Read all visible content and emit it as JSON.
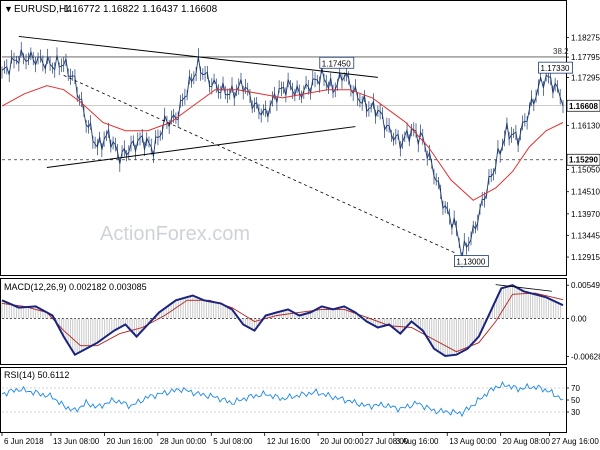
{
  "chart_data": [
    {
      "type": "line",
      "title": "EURUSD,H4",
      "ohlc": [
        1.16772,
        1.16822,
        1.16437,
        1.16608
      ],
      "subtype": "candlestick",
      "ylim": [
        1.1255,
        1.1875
      ],
      "y_ticks": [
        "1.18275",
        "1.17795",
        "1.17295",
        "1.16608",
        "1.16130",
        "1.15290",
        "1.15050",
        "1.14510",
        "1.13970",
        "1.13445",
        "1.12915"
      ],
      "x_ticks": [
        "6 Jun 2018",
        "13 Jun 08:00",
        "20 Jun 16:00",
        "28 Jun 00:00",
        "5 Jul 08:00",
        "12 Jul 16:00",
        "20 Jul 00:00",
        "27 Jul 08:00",
        "3 Aug 16:00",
        "13 Aug 00:00",
        "20 Aug 08:00",
        "27 Aug 16:00"
      ],
      "price_path": [
        [
          0,
          1.174
        ],
        [
          3,
          1.178
        ],
        [
          6,
          1.1775
        ],
        [
          9,
          1.176
        ],
        [
          11,
          1.1765
        ],
        [
          13,
          1.172
        ],
        [
          15,
          1.1625
        ],
        [
          17,
          1.156
        ],
        [
          19,
          1.159
        ],
        [
          21,
          1.1535
        ],
        [
          23,
          1.156
        ],
        [
          25,
          1.158
        ],
        [
          27,
          1.1555
        ],
        [
          29,
          1.162
        ],
        [
          31,
          1.163
        ],
        [
          33,
          1.17
        ],
        [
          35,
          1.176
        ],
        [
          37,
          1.172
        ],
        [
          39,
          1.17
        ],
        [
          41,
          1.169
        ],
        [
          43,
          1.1715
        ],
        [
          45,
          1.166
        ],
        [
          47,
          1.164
        ],
        [
          49,
          1.169
        ],
        [
          51,
          1.171
        ],
        [
          53,
          1.169
        ],
        [
          55,
          1.171
        ],
        [
          57,
          1.1735
        ],
        [
          59,
          1.17
        ],
        [
          61,
          1.174
        ],
        [
          63,
          1.169
        ],
        [
          65,
          1.166
        ],
        [
          67,
          1.165
        ],
        [
          69,
          1.16
        ],
        [
          71,
          1.157
        ],
        [
          73,
          1.16
        ],
        [
          75,
          1.158
        ],
        [
          77,
          1.15
        ],
        [
          79,
          1.141
        ],
        [
          81,
          1.136
        ],
        [
          82,
          1.13
        ],
        [
          84,
          1.135
        ],
        [
          86,
          1.144
        ],
        [
          88,
          1.152
        ],
        [
          90,
          1.16
        ],
        [
          92,
          1.158
        ],
        [
          94,
          1.165
        ],
        [
          96,
          1.1715
        ],
        [
          97,
          1.1733
        ],
        [
          99,
          1.17
        ],
        [
          100,
          1.16608
        ]
      ],
      "ma_path": [
        [
          0,
          1.166
        ],
        [
          4,
          1.169
        ],
        [
          8,
          1.171
        ],
        [
          11,
          1.17
        ],
        [
          14,
          1.167
        ],
        [
          18,
          1.162
        ],
        [
          22,
          1.16
        ],
        [
          26,
          1.16
        ],
        [
          30,
          1.162
        ],
        [
          34,
          1.166
        ],
        [
          38,
          1.17
        ],
        [
          42,
          1.17
        ],
        [
          46,
          1.169
        ],
        [
          50,
          1.168
        ],
        [
          54,
          1.169
        ],
        [
          58,
          1.17
        ],
        [
          62,
          1.17
        ],
        [
          66,
          1.168
        ],
        [
          70,
          1.164
        ],
        [
          72,
          1.162
        ],
        [
          76,
          1.156
        ],
        [
          80,
          1.148
        ],
        [
          84,
          1.143
        ],
        [
          88,
          1.146
        ],
        [
          91,
          1.15
        ],
        [
          94,
          1.156
        ],
        [
          97,
          1.16
        ],
        [
          100,
          1.162
        ]
      ],
      "support_line": [
        [
          8,
          1.151
        ],
        [
          63,
          1.161
        ]
      ],
      "resistance_line": [
        [
          3,
          1.183
        ],
        [
          67,
          1.173
        ]
      ],
      "trend_dotted": [
        [
          11,
          1.1735
        ],
        [
          81,
          1.13
        ]
      ],
      "fib_level": 1.178,
      "fib_label": "38.2",
      "dotted_level": 1.1529,
      "price_labels": [
        {
          "text": "1.17450",
          "x": 57,
          "y": 1.1745
        },
        {
          "text": "1.17330",
          "x": 96,
          "y": 1.1733
        },
        {
          "text": "1.13000",
          "x": 81,
          "y": 1.13
        }
      ],
      "right_labels": [
        {
          "text": "1.16608",
          "value": 1.16608
        },
        {
          "text": "1.15290",
          "value": 1.1529
        }
      ],
      "watermark": "ActionForex.com"
    },
    {
      "type": "line",
      "title": "MACD(12,26,9) 0.002182 0.003085",
      "ylim": [
        -0.0072,
        0.0062
      ],
      "y_ticks": [
        "0.005499",
        "0.00",
        "-0.006283"
      ],
      "macd_path": [
        [
          0,
          0.003
        ],
        [
          3,
          0.0018
        ],
        [
          6,
          0.002
        ],
        [
          9,
          0.0005
        ],
        [
          11,
          -0.003
        ],
        [
          13,
          -0.006
        ],
        [
          15,
          -0.005
        ],
        [
          17,
          -0.004
        ],
        [
          20,
          -0.002
        ],
        [
          22,
          -0.001
        ],
        [
          24,
          -0.003
        ],
        [
          26,
          -0.001
        ],
        [
          28,
          0.001
        ],
        [
          31,
          0.003
        ],
        [
          34,
          0.0038
        ],
        [
          36,
          0.003
        ],
        [
          39,
          0.0025
        ],
        [
          41,
          0.0015
        ],
        [
          43,
          -0.001
        ],
        [
          45,
          -0.002
        ],
        [
          47,
          0.0005
        ],
        [
          49,
          0.001
        ],
        [
          51,
          0.0015
        ],
        [
          53,
          0.0005
        ],
        [
          55,
          0.001
        ],
        [
          57,
          0.002
        ],
        [
          59,
          0.0015
        ],
        [
          61,
          0.002
        ],
        [
          63,
          0.001
        ],
        [
          65,
          -0.0005
        ],
        [
          67,
          -0.0015
        ],
        [
          69,
          -0.001
        ],
        [
          71,
          -0.0025
        ],
        [
          73,
          -0.0005
        ],
        [
          75,
          -0.002
        ],
        [
          77,
          -0.005
        ],
        [
          79,
          -0.0062
        ],
        [
          81,
          -0.006
        ],
        [
          83,
          -0.005
        ],
        [
          85,
          -0.003
        ],
        [
          87,
          0.001
        ],
        [
          89,
          0.005
        ],
        [
          91,
          0.0055
        ],
        [
          93,
          0.0045
        ],
        [
          95,
          0.004
        ],
        [
          97,
          0.0035
        ],
        [
          100,
          0.0022
        ]
      ],
      "signal_path": [
        [
          0,
          0.0025
        ],
        [
          4,
          0.002
        ],
        [
          8,
          0.001
        ],
        [
          11,
          -0.002
        ],
        [
          14,
          -0.0045
        ],
        [
          17,
          -0.0045
        ],
        [
          21,
          -0.0025
        ],
        [
          25,
          -0.0015
        ],
        [
          29,
          0.0005
        ],
        [
          33,
          0.003
        ],
        [
          37,
          0.003
        ],
        [
          41,
          0.0018
        ],
        [
          45,
          -0.0005
        ],
        [
          49,
          0.0005
        ],
        [
          53,
          0.001
        ],
        [
          57,
          0.0015
        ],
        [
          61,
          0.0015
        ],
        [
          65,
          0.0002
        ],
        [
          69,
          -0.0012
        ],
        [
          73,
          -0.0015
        ],
        [
          77,
          -0.0035
        ],
        [
          81,
          -0.0055
        ],
        [
          85,
          -0.004
        ],
        [
          88,
          -0.0005
        ],
        [
          91,
          0.004
        ],
        [
          95,
          0.0042
        ],
        [
          100,
          0.0031
        ]
      ],
      "divergence_line": [
        [
          88,
          0.0056
        ],
        [
          98,
          0.0045
        ]
      ]
    },
    {
      "type": "line",
      "title": "RSI(14) 50.6112",
      "ylim": [
        0,
        100
      ],
      "y_ticks": [
        "70",
        "50",
        "30"
      ],
      "rsi_path": [
        [
          0,
          60
        ],
        [
          3,
          68
        ],
        [
          6,
          62
        ],
        [
          9,
          55
        ],
        [
          11,
          40
        ],
        [
          13,
          32
        ],
        [
          15,
          45
        ],
        [
          17,
          38
        ],
        [
          20,
          50
        ],
        [
          23,
          40
        ],
        [
          26,
          55
        ],
        [
          29,
          62
        ],
        [
          32,
          68
        ],
        [
          35,
          60
        ],
        [
          38,
          55
        ],
        [
          41,
          45
        ],
        [
          44,
          55
        ],
        [
          47,
          60
        ],
        [
          50,
          52
        ],
        [
          53,
          58
        ],
        [
          56,
          63
        ],
        [
          59,
          55
        ],
        [
          62,
          48
        ],
        [
          65,
          40
        ],
        [
          68,
          42
        ],
        [
          71,
          35
        ],
        [
          74,
          45
        ],
        [
          77,
          32
        ],
        [
          80,
          30
        ],
        [
          82,
          28
        ],
        [
          84,
          42
        ],
        [
          86,
          58
        ],
        [
          88,
          72
        ],
        [
          90,
          75
        ],
        [
          92,
          68
        ],
        [
          94,
          72
        ],
        [
          96,
          70
        ],
        [
          98,
          62
        ],
        [
          100,
          50.6
        ]
      ]
    }
  ]
}
